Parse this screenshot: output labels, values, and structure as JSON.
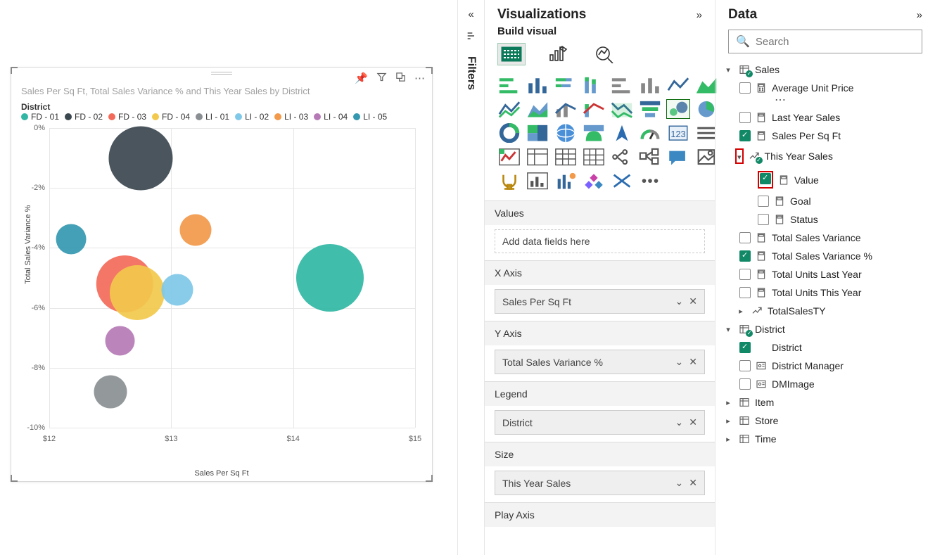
{
  "viz_panel": {
    "title": "Visualizations",
    "subtitle": "Build visual",
    "wells": {
      "values": {
        "label": "Values",
        "placeholder": "Add data fields here"
      },
      "x_axis": {
        "label": "X Axis",
        "field": "Sales Per Sq Ft"
      },
      "y_axis": {
        "label": "Y Axis",
        "field": "Total Sales Variance %"
      },
      "legend": {
        "label": "Legend",
        "field": "District"
      },
      "size": {
        "label": "Size",
        "field": "This Year Sales"
      },
      "play_axis": {
        "label": "Play Axis"
      }
    }
  },
  "filters_label": "Filters",
  "data_panel": {
    "title": "Data",
    "search_placeholder": "Search",
    "tables": {
      "sales": {
        "name": "Sales",
        "fields": {
          "avg_unit_price": "Average Unit Price",
          "last_year_sales": "Last Year Sales",
          "sales_per_sq_ft": "Sales Per Sq Ft",
          "this_year_sales": "This Year Sales",
          "value": "Value",
          "goal": "Goal",
          "status": "Status",
          "total_sales_variance": "Total Sales Variance",
          "total_sales_variance_pct": "Total Sales Variance %",
          "total_units_last_year": "Total Units Last Year",
          "total_units_this_year": "Total Units This Year",
          "total_sales_ty": "TotalSalesTY"
        }
      },
      "district": {
        "name": "District",
        "fields": {
          "district": "District",
          "district_manager": "District Manager",
          "dm_image": "DMImage"
        }
      },
      "item": {
        "name": "Item"
      },
      "store": {
        "name": "Store"
      },
      "time": {
        "name": "Time"
      }
    }
  },
  "chart": {
    "title": "Sales Per Sq Ft, Total Sales Variance % and This Year Sales by District",
    "legend_title": "District",
    "x_axis_label": "Sales Per Sq Ft",
    "y_axis_label": "Total Sales Variance %"
  },
  "chart_data": {
    "type": "scatter",
    "title": "Sales Per Sq Ft, Total Sales Variance % and This Year Sales by District",
    "xlabel": "Sales Per Sq Ft",
    "ylabel": "Total Sales Variance %",
    "xlim": [
      12,
      15
    ],
    "ylim": [
      -10,
      0
    ],
    "x_ticks": [
      12,
      13,
      14,
      15
    ],
    "y_ticks": [
      0,
      -2,
      -4,
      -6,
      -8,
      -10
    ],
    "x_tick_labels": [
      "$12",
      "$13",
      "$14",
      "$15"
    ],
    "y_tick_labels": [
      "0%",
      "-2%",
      "-4%",
      "-6%",
      "-8%",
      "-10%"
    ],
    "size_field": "This Year Sales",
    "legend_field": "District",
    "series": [
      {
        "name": "FD - 01",
        "color": "#31b7a4",
        "x": 14.3,
        "y": -5.0,
        "size": 1.0
      },
      {
        "name": "FD - 02",
        "color": "#3b474f",
        "x": 12.75,
        "y": -1.0,
        "size": 0.9
      },
      {
        "name": "FD - 03",
        "color": "#f36a5a",
        "x": 12.62,
        "y": -5.2,
        "size": 0.7
      },
      {
        "name": "FD - 04",
        "color": "#f2c94c",
        "x": 12.72,
        "y": -5.5,
        "size": 0.66
      },
      {
        "name": "LI - 01",
        "color": "#8a8f93",
        "x": 12.5,
        "y": -8.8,
        "size": 0.24
      },
      {
        "name": "LI - 02",
        "color": "#7fc8e8",
        "x": 13.05,
        "y": -5.4,
        "size": 0.22
      },
      {
        "name": "LI - 03",
        "color": "#f2994a",
        "x": 13.2,
        "y": -3.4,
        "size": 0.22
      },
      {
        "name": "LI - 04",
        "color": "#b57ab5",
        "x": 12.58,
        "y": -7.1,
        "size": 0.2
      },
      {
        "name": "LI - 05",
        "color": "#3498b0",
        "x": 12.18,
        "y": -3.7,
        "size": 0.2
      }
    ]
  }
}
